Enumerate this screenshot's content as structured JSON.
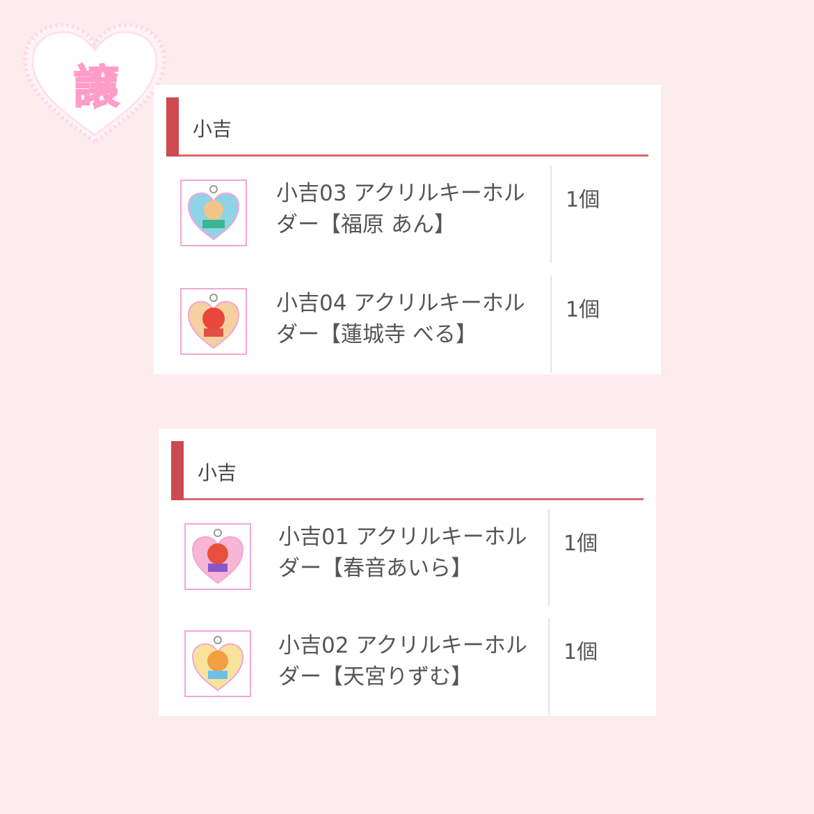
{
  "badge": {
    "text": "譲",
    "color": "#ffc0dd"
  },
  "colors": {
    "accent": "#cc4a50",
    "underline": "#d66a6f",
    "background": "#fdecee",
    "thumb_border": "#f2a6d6"
  },
  "sections": [
    {
      "title": "小吉",
      "items": [
        {
          "name": "小吉03 アクリルキーホルダー【福原 あん】",
          "qty": "1個",
          "icon": "acrylic-keychain-heart-teal"
        },
        {
          "name": "小吉04 アクリルキーホルダー【蓮城寺 べる】",
          "qty": "1個",
          "icon": "acrylic-keychain-heart-red"
        }
      ]
    },
    {
      "title": "小吉",
      "items": [
        {
          "name": "小吉01 アクリルキーホルダー【春音あいら】",
          "qty": "1個",
          "icon": "acrylic-keychain-heart-pink"
        },
        {
          "name": "小吉02 アクリルキーホルダー【天宮りずむ】",
          "qty": "1個",
          "icon": "acrylic-keychain-heart-yellow"
        }
      ]
    }
  ]
}
